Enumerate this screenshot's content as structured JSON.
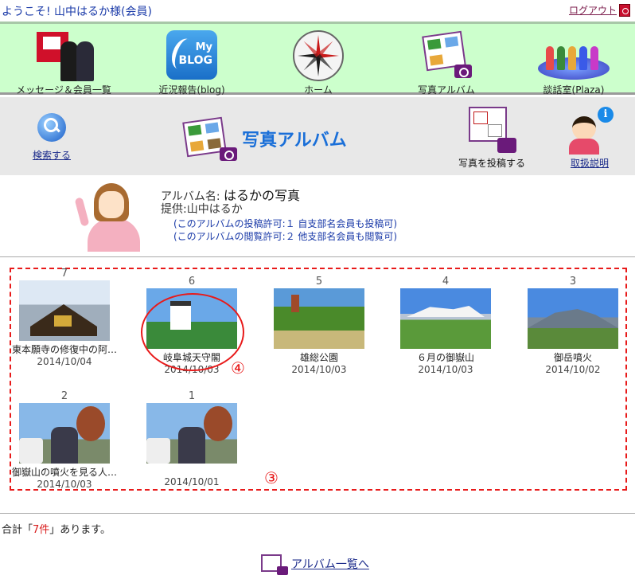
{
  "header": {
    "welcome": "ようこそ! 山中はるか様(会員)",
    "logout_label": "ログアウト"
  },
  "nav": {
    "items": [
      {
        "label": "メッセージ＆会員一覧",
        "icon": "message-members-icon"
      },
      {
        "label": "近況報告(blog)",
        "icon": "blog-icon",
        "blog_line1": "My",
        "blog_line2": "BLOG"
      },
      {
        "label": "ホーム",
        "icon": "compass-icon"
      },
      {
        "label": "写真アルバム",
        "icon": "photo-album-icon"
      },
      {
        "label": "談話室(Plaza)",
        "icon": "plaza-icon"
      }
    ]
  },
  "subheader": {
    "search_label": "検索する",
    "title": "写真アルバム",
    "post_label": "写真を投稿する",
    "help_label": "取扱説明",
    "help_badge": "i"
  },
  "album": {
    "name_prefix": "アルバム名: ",
    "name": "はるかの写真",
    "provider": "提供:山中はるか",
    "post_permission": "(このアルバムの投稿許可:１ 自支部名会員も投稿可)",
    "view_permission": "(このアルバムの閲覧許可:２ 他支部名会員も閲覧可)"
  },
  "photos": [
    {
      "num": "7",
      "caption": "東本願寺の修復中の阿…",
      "date": "2014/10/04",
      "img": "temple"
    },
    {
      "num": "6",
      "caption": "岐阜城天守閣",
      "date": "2014/10/03",
      "img": "castle"
    },
    {
      "num": "5",
      "caption": "雄総公園",
      "date": "2014/10/03",
      "img": "park"
    },
    {
      "num": "4",
      "caption": "６月の御嶽山",
      "date": "2014/10/03",
      "img": "ontake1"
    },
    {
      "num": "3",
      "caption": "御岳噴火",
      "date": "2014/10/02",
      "img": "ontake2"
    },
    {
      "num": "2",
      "caption": "御嶽山の噴火を見る人…",
      "date": "2014/10/03",
      "img": "people"
    },
    {
      "num": "1",
      "caption": "",
      "date": "2014/10/01",
      "img": "people"
    }
  ],
  "annotations": {
    "mark4": "④",
    "mark3": "③"
  },
  "footer": {
    "total_prefix": "合計「",
    "total_count": "7件",
    "total_suffix": "」あります。",
    "back_label": "アルバム一覧へ"
  }
}
